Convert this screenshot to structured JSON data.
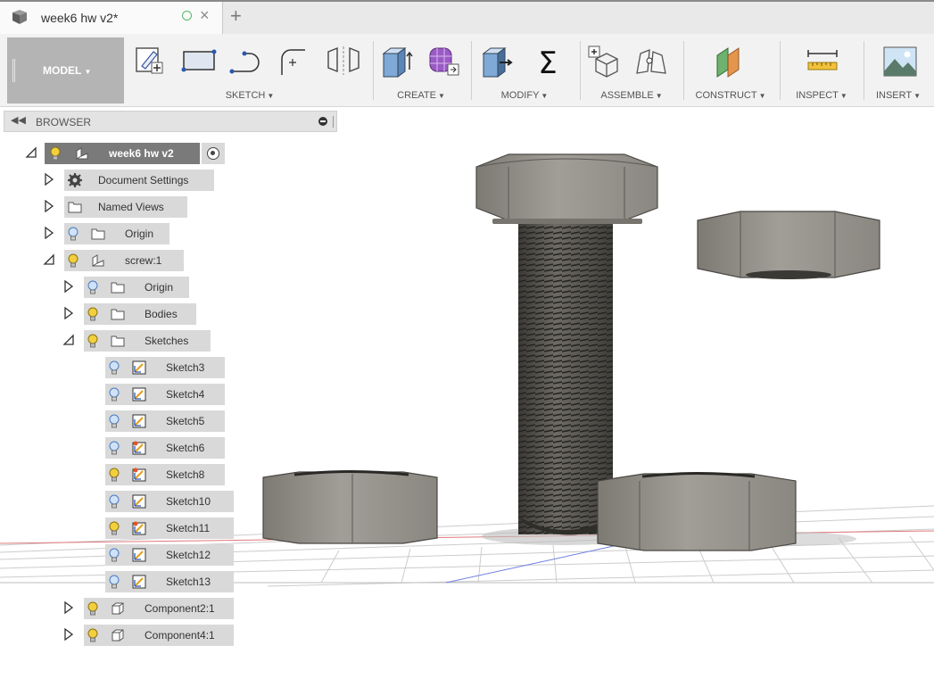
{
  "document_tab": {
    "title": "week6 hw v2*",
    "close_glyph": "×",
    "new_tab_glyph": "+"
  },
  "toolbar": {
    "workspace_label": "MODEL",
    "groups": [
      {
        "label": "SKETCH",
        "tools": [
          "create-sketch",
          "rectangle",
          "line-arc",
          "fillet",
          "mirror"
        ]
      },
      {
        "label": "CREATE",
        "tools": [
          "extrude",
          "form"
        ]
      },
      {
        "label": "MODIFY",
        "tools": [
          "press-pull",
          "parameters"
        ]
      },
      {
        "label": "ASSEMBLE",
        "tools": [
          "new-component",
          "joint"
        ]
      },
      {
        "label": "CONSTRUCT",
        "tools": [
          "offset-plane"
        ]
      },
      {
        "label": "INSPECT",
        "tools": [
          "measure"
        ]
      },
      {
        "label": "INSERT",
        "tools": [
          "insert-image"
        ]
      }
    ]
  },
  "browser": {
    "title": "BROWSER",
    "root": {
      "label": "week6 hw v2",
      "icon": "component-icon"
    },
    "items": [
      {
        "label": "Document Settings",
        "icon": "gear-icon",
        "bulb": "none",
        "expanded": false
      },
      {
        "label": "Named Views",
        "icon": "folder-icon",
        "bulb": "none",
        "expanded": false
      },
      {
        "label": "Origin",
        "icon": "folder-icon",
        "bulb": "off",
        "expanded": false
      },
      {
        "label": "screw:1",
        "icon": "component-icon",
        "bulb": "on",
        "expanded": true
      },
      {
        "label": "Origin",
        "icon": "folder-icon",
        "bulb": "off",
        "expanded": false
      },
      {
        "label": "Bodies",
        "icon": "folder-icon",
        "bulb": "on",
        "expanded": false
      },
      {
        "label": "Sketches",
        "icon": "folder-icon",
        "bulb": "on",
        "expanded": true
      },
      {
        "label": "Sketch3",
        "icon": "sketch-icon",
        "bulb": "off"
      },
      {
        "label": "Sketch4",
        "icon": "sketch-icon",
        "bulb": "off"
      },
      {
        "label": "Sketch5",
        "icon": "sketch-icon",
        "bulb": "off"
      },
      {
        "label": "Sketch6",
        "icon": "sketch-warning-icon",
        "bulb": "off"
      },
      {
        "label": "Sketch8",
        "icon": "sketch-warning-icon",
        "bulb": "on"
      },
      {
        "label": "Sketch10",
        "icon": "sketch-icon",
        "bulb": "off"
      },
      {
        "label": "Sketch11",
        "icon": "sketch-warning-icon",
        "bulb": "on"
      },
      {
        "label": "Sketch12",
        "icon": "sketch-icon",
        "bulb": "off"
      },
      {
        "label": "Sketch13",
        "icon": "sketch-icon",
        "bulb": "off"
      },
      {
        "label": "Component2:1",
        "icon": "body-icon",
        "bulb": "on",
        "expanded": false
      },
      {
        "label": "Component4:1",
        "icon": "body-icon",
        "bulb": "on",
        "expanded": false
      }
    ]
  },
  "viewport": {
    "scene": "bolt-and-nuts",
    "colors": {
      "metal": "#8f8c85",
      "grid": "#c9c9c9",
      "x_axis": "#e07a7a",
      "y_axis": "#6f7fe0"
    }
  }
}
